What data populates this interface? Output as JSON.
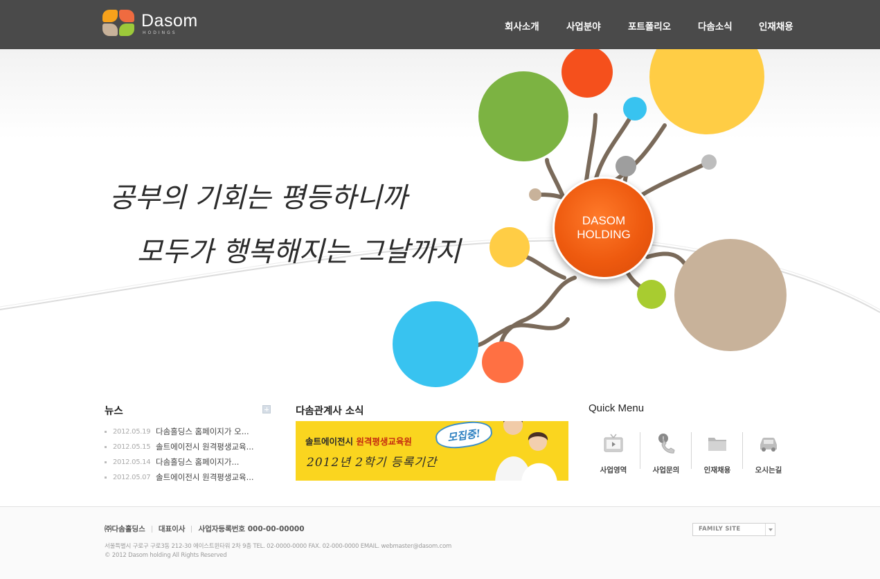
{
  "header": {
    "logo_name": "Dasom",
    "logo_sub": "HODINGS",
    "nav": [
      "회사소개",
      "사업분야",
      "포트폴리오",
      "다솜소식",
      "인재채용"
    ]
  },
  "hero": {
    "slogan_line1": "공부의 기회는 평등하니까",
    "slogan_line2": "모두가 행복해지는 그날까지",
    "hub_label": "DASOM\nHOLDING",
    "colors": {
      "green": "#7cb342",
      "red_orange": "#f5501c",
      "sky_blue": "#38c3f0",
      "yellow": "#ffcd45",
      "tan": "#c8b29a",
      "light_green": "#a8cc30",
      "coral": "#ff7043",
      "gray": "#9e9e9e",
      "hub_orange": "#ee5a0f"
    }
  },
  "news": {
    "title": "뉴스",
    "more_icon": "plus-icon",
    "items": [
      {
        "date": "2012.05.19",
        "title": "다솜홀딩스 홈페이지가 오..."
      },
      {
        "date": "2012.05.15",
        "title": "솔트에이전시 원격평생교육..."
      },
      {
        "date": "2012.05.14",
        "title": "다솜홀딩스 홈페이지가..."
      },
      {
        "date": "2012.05.07",
        "title": "솔트에이전시 원격평생교육..."
      }
    ]
  },
  "affiliates": {
    "title": "다솜관계사 소식",
    "banner_line1_prefix": "솔트에이전시 ",
    "banner_line1_highlight": "원격평생교육원",
    "banner_line2": "2012년 2학기 등록기간",
    "banner_bubble": "모집중!"
  },
  "quick_menu": {
    "title": "Quick Menu",
    "items": [
      {
        "label": "사업영역",
        "icon": "tv-icon"
      },
      {
        "label": "사업문의",
        "icon": "phone-icon"
      },
      {
        "label": "인재채용",
        "icon": "folder-icon"
      },
      {
        "label": "오시는길",
        "icon": "car-icon"
      }
    ]
  },
  "footer": {
    "company": "㈜다솜홀딩스",
    "ceo": "대표이사",
    "biz_no": "사업자등록번호 000-00-00000",
    "address": "서울특별시 구로구 구로3동 212-30 에이스트윈타워 2차 9층   TEL. 02-0000-0000   FAX. 02-000-0000   EMAIL. webmaster@dasom.com",
    "copyright": "© 2012 Dasom holding All Rights Reserved",
    "family_site": "FAMILY SITE"
  }
}
